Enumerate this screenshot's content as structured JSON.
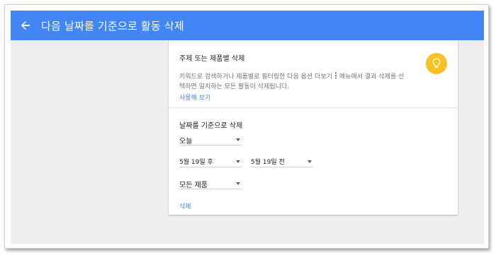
{
  "header": {
    "title": "다음 날짜를 기준으로 활동 삭제"
  },
  "topic_section": {
    "title": "주제 또는 제품별 삭제",
    "desc_part1": "키워드로 검색하거나 제품별로 필터링한 다음 옵션 더보기",
    "desc_part2": "메뉴에서 결과 삭제를 선",
    "desc_line2": "택하면 일치하는 모든 활동이 삭제됩니다.",
    "try_link": "사용해 보기"
  },
  "date_section": {
    "title": "날짜를 기준으로 삭제",
    "range_value": "오늘",
    "after_value": "5월 19일 후",
    "before_value": "5월 19일 전",
    "product_value": "모든 제품",
    "delete_label": "삭제"
  },
  "colors": {
    "app_bar": "#4285f4",
    "link": "#4285f4",
    "bulb": "#f6c026",
    "background": "#eeeeee"
  },
  "icons": {
    "back": "arrow-left",
    "more": "vertical-dots",
    "tip": "lightbulb"
  }
}
